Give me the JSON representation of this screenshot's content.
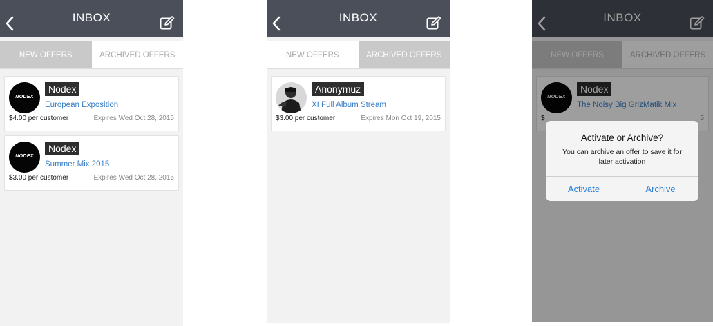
{
  "screens": [
    {
      "title": "INBOX",
      "tabs": [
        {
          "label": "NEW OFFERS",
          "active": true
        },
        {
          "label": "ARCHIVED OFFERS",
          "active": false
        }
      ],
      "offers": [
        {
          "brand": "Nodex",
          "logo_text": "NODEX",
          "title": "European Exposition",
          "price": "$4.00 per customer",
          "expires": "Expires Wed Oct 28, 2015"
        },
        {
          "brand": "Nodex",
          "logo_text": "NODEX",
          "title": "Summer Mix 2015",
          "price": "$3.00 per customer",
          "expires": "Expires Wed Oct 28, 2015"
        }
      ]
    },
    {
      "title": "INBOX",
      "tabs": [
        {
          "label": "NEW OFFERS",
          "active": false
        },
        {
          "label": "ARCHIVED OFFERS",
          "active": true
        }
      ],
      "offers": [
        {
          "brand": "Anonymuz",
          "title": "XI Full Album Stream",
          "price": "$3.00 per customer",
          "expires": "Expires Mon Oct 19, 2015"
        }
      ]
    },
    {
      "title": "INBOX",
      "tabs": [
        {
          "label": "NEW OFFERS",
          "active": true
        },
        {
          "label": "ARCHIVED OFFERS",
          "active": false
        }
      ],
      "offers": [
        {
          "brand": "Nodex",
          "logo_text": "NODEX",
          "title": "The Noisy Big GrizMatik Mix",
          "price": "$",
          "expires": "5"
        }
      ],
      "alert": {
        "title": "Activate or Archive?",
        "message": "You can archive an offer to save it for later activation",
        "buttons": [
          "Activate",
          "Archive"
        ]
      }
    }
  ],
  "colors": {
    "navbar": "#4a4f59",
    "link": "#3a7fc4",
    "alert_button": "#2a7fd8",
    "active_tab": "#c9c9c9"
  },
  "icons": [
    "back-chevron-icon",
    "compose-icon"
  ]
}
